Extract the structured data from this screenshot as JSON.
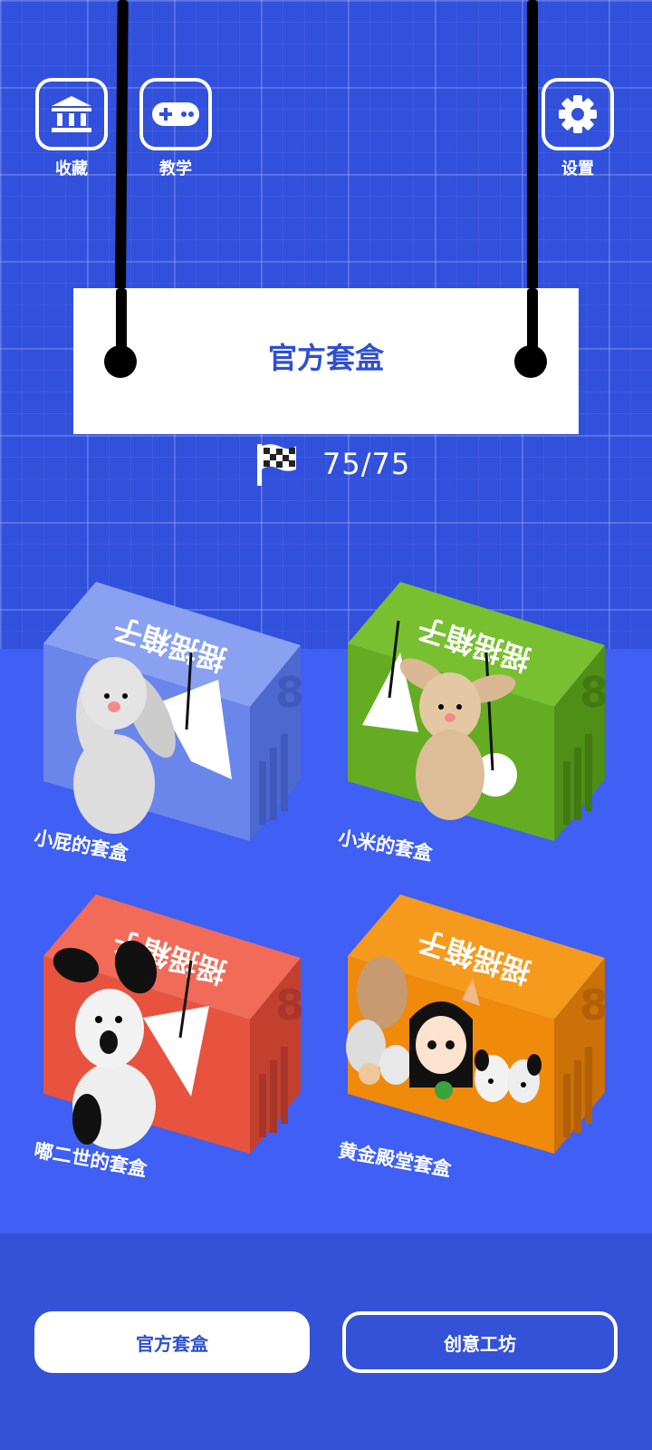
{
  "top_bar": {
    "collection_label": "收藏",
    "tutorial_label": "教学",
    "settings_label": "设置"
  },
  "sign": {
    "title": "官方套盒"
  },
  "progress": {
    "text": "75/75"
  },
  "boxes": [
    {
      "label": "小屁的套盒",
      "color": "#6b86ea"
    },
    {
      "label": "小米的套盒",
      "color": "#64ad22"
    },
    {
      "label": "嘟二世的套盒",
      "color": "#e7533e"
    },
    {
      "label": "黄金殿堂套盒",
      "color": "#ef8a0a"
    }
  ],
  "box_brand_text": "摇摇箱子",
  "bottom_nav": {
    "official_label": "官方套盒",
    "workshop_label": "创意工坊"
  }
}
